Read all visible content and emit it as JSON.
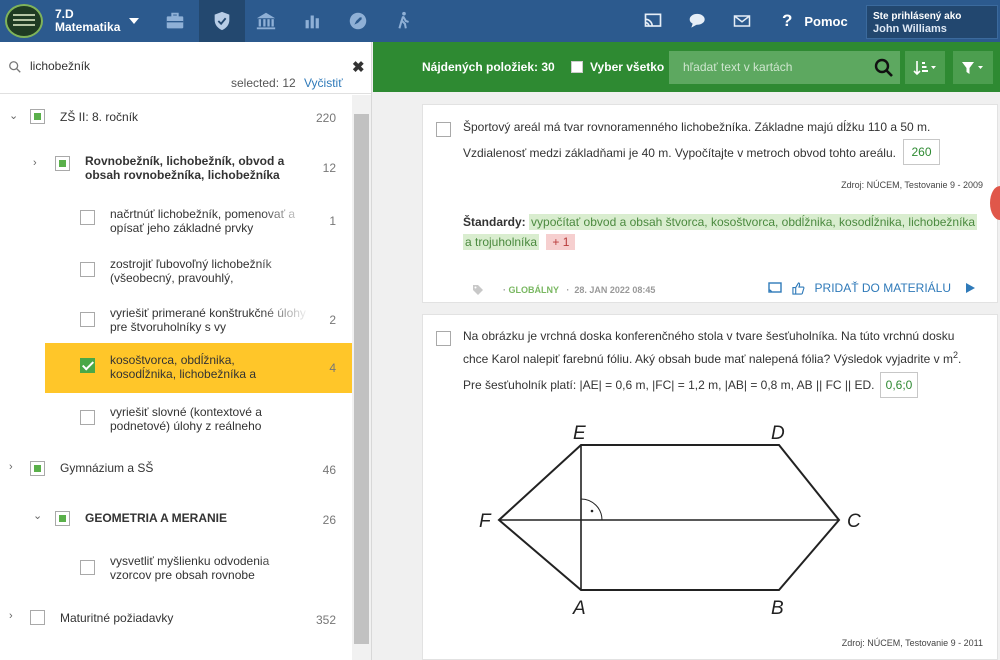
{
  "app": {
    "class_label": "7.D",
    "subject_label": "Matematika"
  },
  "nav": {
    "icons": [
      "briefcase-icon",
      "shield-icon",
      "institution-icon",
      "bar-chart-icon",
      "rocket-icon",
      "hiking-icon"
    ],
    "right_icons": [
      "cast-icon",
      "chat-icon",
      "mail-icon"
    ],
    "help_label": "Pomoc",
    "user_caption": "Ste prihlásený ako",
    "user_name": "John Williams"
  },
  "sidebar": {
    "search_value": "lichobežník",
    "selected_text": "selected: 12",
    "clear_link": "Vyčistiť",
    "tree": [
      {
        "label": "ZŠ II: 8. ročník",
        "count": "220",
        "state": "partial",
        "bold": false
      },
      {
        "label": "Rovnobežník, lichobežník, obvod a obsah rovnobežníka, lichobežníka",
        "count": "12",
        "state": "partial",
        "bold": true
      },
      {
        "label": "načrtnúť lichobežník, pomenovať a opísať jeho základné prvky",
        "count": "1",
        "state": "unchecked",
        "bold": false
      },
      {
        "label": "zostrojiť ľubovoľný lichobežník (všeobecný, pravouhlý,",
        "count": "",
        "state": "unchecked",
        "bold": false
      },
      {
        "label": "vyriešiť primerané konštrukčné úlohy pre štvoruholníky s vy",
        "count": "2",
        "state": "unchecked",
        "bold": false
      },
      {
        "label": "kosoštvorca, obdĺžnika, kosodĺžnika, lichobežníka a",
        "count": "4",
        "state": "checked",
        "bold": false
      },
      {
        "label": "vyriešiť slovné (kontextové a podnetové) úlohy z reálneho",
        "count": "",
        "state": "unchecked",
        "bold": false
      },
      {
        "label": "Gymnázium a SŠ",
        "count": "46",
        "state": "partial",
        "bold": false
      },
      {
        "label": "GEOMETRIA A MERANIE",
        "count": "26",
        "state": "partial",
        "bold": true
      },
      {
        "label": "vysvetliť myšlienku odvodenia vzorcov pre obsah rovnobe",
        "count": "",
        "state": "unchecked",
        "bold": false
      },
      {
        "label": "Maturitné požiadavky",
        "count": "352",
        "state": "unchecked",
        "bold": false
      }
    ]
  },
  "toolbar": {
    "found_label": "Nájdených položiek: 30",
    "select_all_label": "Vyber všetko",
    "search_placeholder": "hľadať text v kartách"
  },
  "cards": [
    {
      "text_line1": "Športový areál má tvar rovnoramenného lichobežníka. Základne majú dĺžku 110 a 50 m.",
      "text_line2": "Vzdialenosť medzi základňami je 40 m. Vypočítajte v metroch obvod tohto areálu.",
      "answer": "260",
      "source": "Zdroj: NÚCEM, Testovanie 9 - 2009",
      "standards_label": "Štandardy:",
      "standards_value_1": "vypočítať obvod a obsah štvorca, kosoštvorca, obdĺžnika, kosodĺžnika, lichobežníka",
      "standards_value_2": "a trojuholníka",
      "standards_more": "+ 1",
      "scope": "GLOBÁLNY",
      "date": "28. JAN 2022 08:45",
      "add_label": "PRIDAŤ DO MATERIÁLU"
    },
    {
      "text_line1": "Na obrázku je vrchná doska konferenčného stola v tvare šesťuholníka. Na túto vrchnú dosku",
      "text_line2": "chce Karol nalepiť farebnú fóliu. Aký obsah bude mať nalepená fólia? Výsledok vyjadrite v m",
      "text_sup": "2",
      "text_line2_end": ".",
      "text_line3": "Pre šesťuholník platí: |AE| = 0,6 m, |FC| = 1,2 m, |AB| = 0,8 m, AB || FC || ED.",
      "answer": "0,6;0",
      "source": "Zdroj: NÚCEM, Testovanie 9 - 2011",
      "figure_labels": [
        "E",
        "D",
        "F",
        "C",
        "A",
        "B"
      ]
    }
  ]
}
